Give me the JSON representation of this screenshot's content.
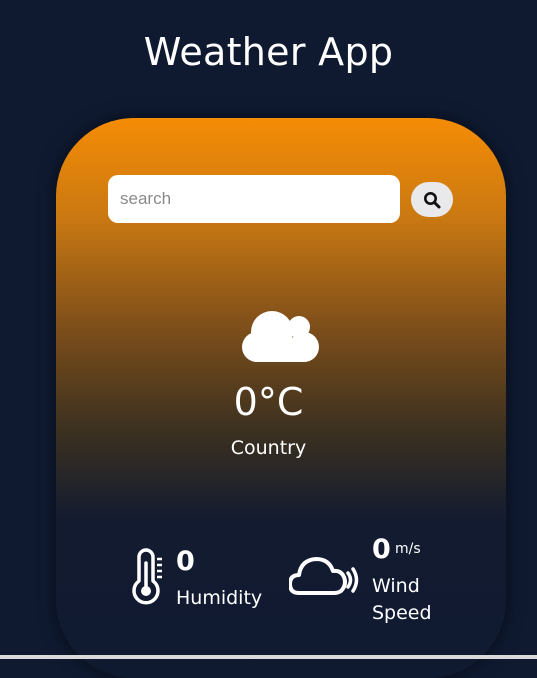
{
  "app": {
    "title": "Weather App"
  },
  "search": {
    "placeholder": "search",
    "value": "",
    "button_icon": "search-icon"
  },
  "current": {
    "icon": "cloud-icon",
    "temperature": "0°C",
    "location": "Country"
  },
  "details": {
    "humidity": {
      "icon": "thermometer-icon",
      "value": "0",
      "label": "Humidity"
    },
    "wind": {
      "icon": "wind-cloud-icon",
      "value": "0",
      "unit": "m/s",
      "label": "Wind Speed"
    }
  },
  "colors": {
    "background": "#0f1a31",
    "card_top": "#f58c05",
    "card_bottom": "#0f1a31",
    "text": "#ffffff",
    "search_button": "#e9e9ec"
  }
}
